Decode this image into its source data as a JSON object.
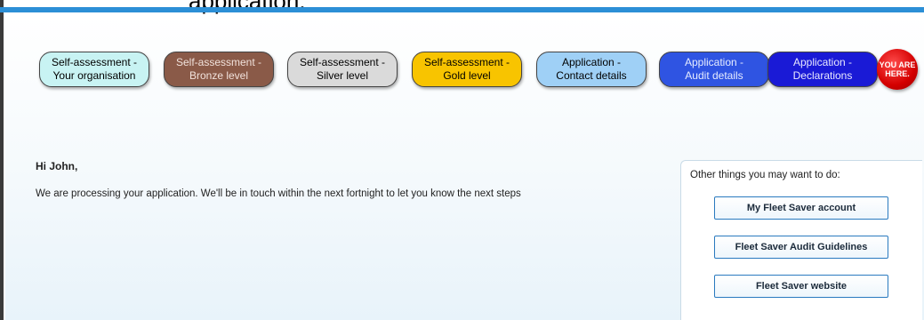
{
  "caption": "application.",
  "progress_steps": [
    {
      "label": "Self-assessment -\nYour organisation"
    },
    {
      "label": "Self-assessment -\nBronze level"
    },
    {
      "label": "Self-assessment -\nSilver level"
    },
    {
      "label": "Self-assessment -\nGold level"
    },
    {
      "label": "Application -\nContact details"
    },
    {
      "label": "Application -\nAudit details"
    },
    {
      "label": "Application -\nDeclarations"
    }
  ],
  "current_marker": "YOU ARE\nHERE.",
  "main": {
    "greeting": "Hi John,",
    "message": "We are processing your application. We'll be in touch within the next fortnight to let you know the next steps"
  },
  "sidebar": {
    "title": "Other things you may want to do:",
    "links": [
      {
        "label": "My Fleet Saver account"
      },
      {
        "label": "Fleet Saver Audit Guidelines"
      },
      {
        "label": "Fleet Saver website"
      }
    ]
  },
  "colors": {
    "accent_bar": "#2c8fd6",
    "step_your_organisation": "#c8f3f3",
    "step_bronze": "#8a5a48",
    "step_silver": "#dadada",
    "step_gold": "#f8c400",
    "step_contact": "#9fd0f6",
    "step_audit": "#2f54e2",
    "step_declarations": "#1a1ad6",
    "you_are_here": "#d40000",
    "button_border": "#2a7abf"
  }
}
